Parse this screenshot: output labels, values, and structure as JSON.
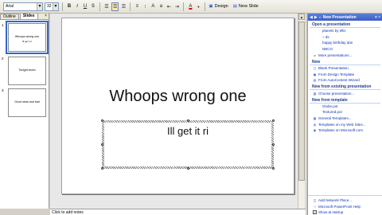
{
  "toolbar": {
    "font_name": "Arial",
    "font_size": "32",
    "bold": "B",
    "italic": "I",
    "underline": "U",
    "shadow": "S",
    "font_color": "A",
    "design_label": "Design",
    "new_slide_label": "New Slide"
  },
  "left_pane": {
    "tabs": [
      "Outline",
      "Slides"
    ],
    "close": "×",
    "slides": [
      {
        "number": "1",
        "title": "Whoops wrong one",
        "subtitle": "Ill get it ri"
      },
      {
        "number": "2",
        "title": "Tonight vision",
        "subtitle": ""
      },
      {
        "number": "3",
        "title": "Good news and bad",
        "subtitle": ""
      }
    ]
  },
  "slide": {
    "title": "Whoops wrong one",
    "subtitle": "Ill get it ri"
  },
  "notes": {
    "placeholder": "Click to add notes"
  },
  "task_pane": {
    "title": "New Presentation",
    "open_section": "Open a presentation",
    "recent_files": [
      "planets by ellis",
      "~ ds",
      "happy birthday dan",
      "NBCO"
    ],
    "more_presentations": "More presentations...",
    "new_section": "New",
    "new_items": [
      "Blank Presentation",
      "From Design Template",
      "From AutoContent Wizard"
    ],
    "existing_section": "New from existing presentation",
    "choose_presentation": "Choose presentation...",
    "template_section": "New from template",
    "template_items": [
      "Globe.pot",
      "Textured.pot",
      "General Templates...",
      "Templates on my Web Sites...",
      "Templates on Microsoft.com"
    ],
    "bottom_items": [
      "Add Network Place...",
      "Microsoft PowerPoint Help",
      "Show at startup"
    ]
  }
}
